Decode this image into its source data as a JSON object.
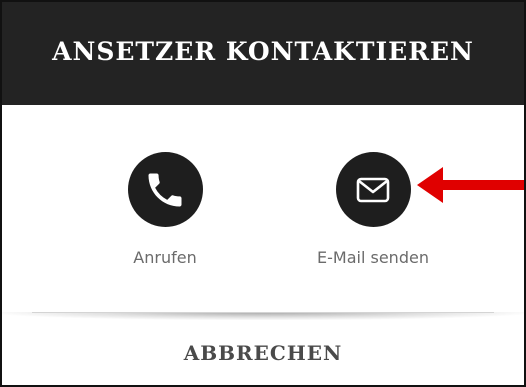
{
  "dialog": {
    "title": "ANSETZER KONTAKTIEREN",
    "actions": [
      {
        "label": "Anrufen",
        "icon": "phone-icon"
      },
      {
        "label": "E-Mail senden",
        "icon": "envelope-icon"
      }
    ],
    "cancel_label": "ABBRECHEN"
  },
  "colors": {
    "header_bg": "#232323",
    "icon_circle": "#1e1e1e",
    "annotation_arrow": "#e00000",
    "label_gray": "#6b6b6b"
  }
}
